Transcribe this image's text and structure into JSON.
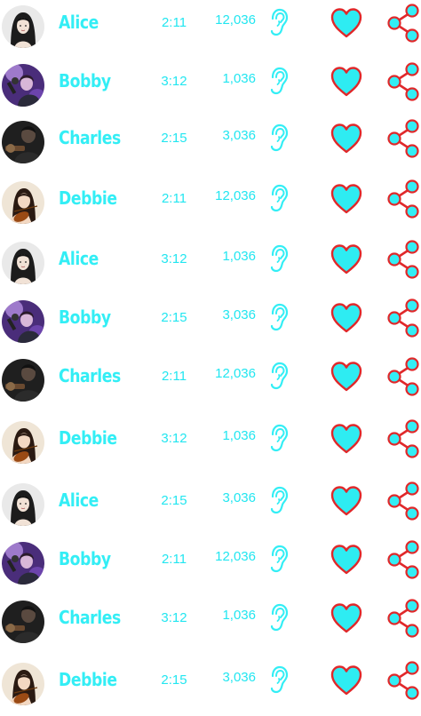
{
  "colors": {
    "accent": "#33eef5",
    "heart_fill": "#2eecf2",
    "heart_outline": "#e0282a",
    "share_node": "#33eef5",
    "share_outline": "#e0282a"
  },
  "icons": {
    "listen": "ear-icon",
    "like": "heart-icon",
    "share": "share-icon"
  },
  "tracks": [
    {
      "name": "Alice",
      "duration": "2:11",
      "plays": "12,036",
      "avatar": "alice"
    },
    {
      "name": "Bobby",
      "duration": "3:12",
      "plays": "1,036",
      "avatar": "bobby"
    },
    {
      "name": "Charles",
      "duration": "2:15",
      "plays": "3,036",
      "avatar": "charles"
    },
    {
      "name": "Debbie",
      "duration": "2:11",
      "plays": "12,036",
      "avatar": "debbie"
    },
    {
      "name": "Alice",
      "duration": "3:12",
      "plays": "1,036",
      "avatar": "alice"
    },
    {
      "name": "Bobby",
      "duration": "2:15",
      "plays": "3,036",
      "avatar": "bobby"
    },
    {
      "name": "Charles",
      "duration": "2:11",
      "plays": "12,036",
      "avatar": "charles"
    },
    {
      "name": "Debbie",
      "duration": "3:12",
      "plays": "1,036",
      "avatar": "debbie"
    },
    {
      "name": "Alice",
      "duration": "2:15",
      "plays": "3,036",
      "avatar": "alice"
    },
    {
      "name": "Bobby",
      "duration": "2:11",
      "plays": "12,036",
      "avatar": "bobby"
    },
    {
      "name": "Charles",
      "duration": "3:12",
      "plays": "1,036",
      "avatar": "charles"
    },
    {
      "name": "Debbie",
      "duration": "2:15",
      "plays": "3,036",
      "avatar": "debbie"
    }
  ]
}
